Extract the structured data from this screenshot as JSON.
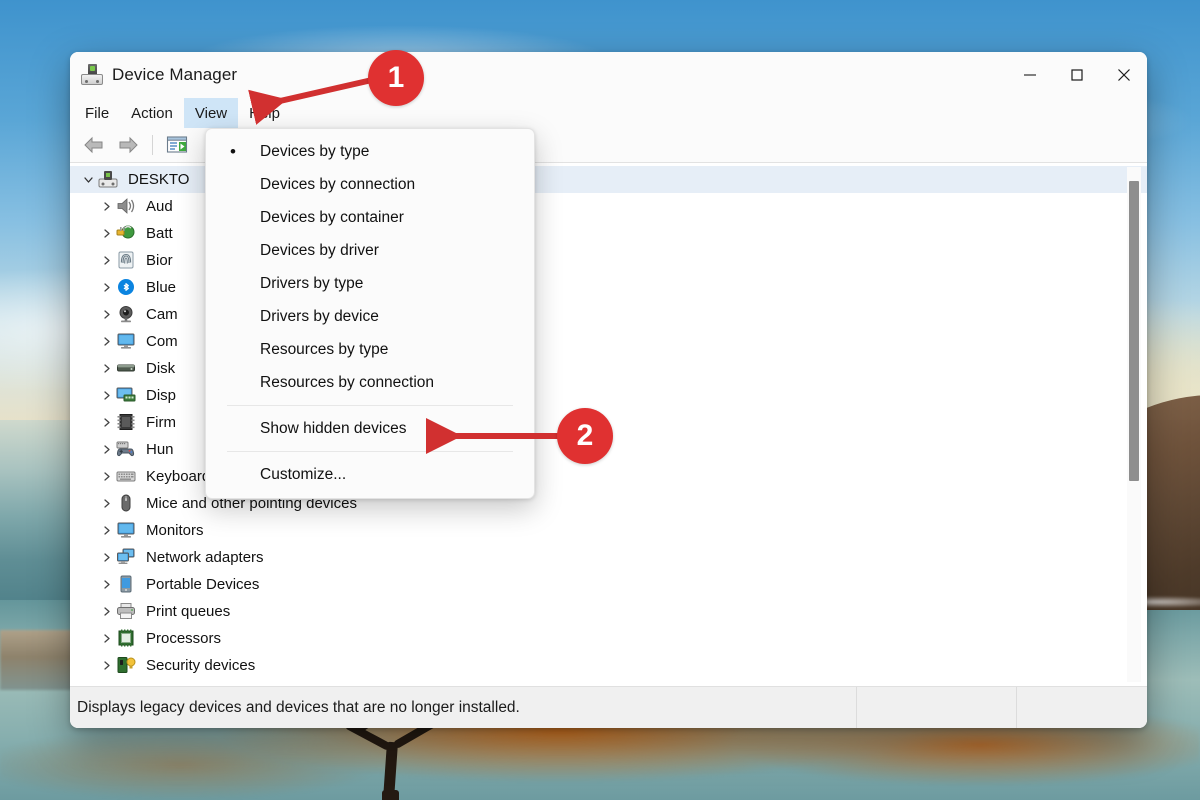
{
  "window": {
    "title": "Device Manager",
    "app_icon": "device-manager-icon",
    "controls": {
      "minimize": "minimize-icon",
      "maximize": "maximize-icon",
      "close": "close-icon"
    }
  },
  "menubar": {
    "items": [
      {
        "label": "File",
        "active": false
      },
      {
        "label": "Action",
        "active": false
      },
      {
        "label": "View",
        "active": true
      },
      {
        "label": "Help",
        "active": false
      }
    ]
  },
  "toolbar": {
    "buttons": [
      {
        "name": "back-button",
        "icon": "back-arrow-icon"
      },
      {
        "name": "forward-button",
        "icon": "forward-arrow-icon"
      },
      {
        "name": "properties-button",
        "icon": "properties-icon"
      }
    ]
  },
  "view_menu": {
    "items": [
      {
        "label": "Devices by type",
        "checked": true
      },
      {
        "label": "Devices by connection",
        "checked": false
      },
      {
        "label": "Devices by container",
        "checked": false
      },
      {
        "label": "Devices by driver",
        "checked": false
      },
      {
        "label": "Drivers by type",
        "checked": false
      },
      {
        "label": "Drivers by device",
        "checked": false
      },
      {
        "label": "Resources by type",
        "checked": false
      },
      {
        "label": "Resources by connection",
        "checked": false
      }
    ],
    "show_hidden": "Show hidden devices",
    "customize": "Customize..."
  },
  "tree": {
    "root": {
      "label": "DESKTO",
      "icon": "computer-icon",
      "expanded": true
    },
    "items": [
      {
        "label": "Aud",
        "icon": "speaker-icon"
      },
      {
        "label": "Batt",
        "icon": "battery-icon"
      },
      {
        "label": "Bior",
        "icon": "fingerprint-icon"
      },
      {
        "label": "Blue",
        "icon": "bluetooth-icon"
      },
      {
        "label": "Cam",
        "icon": "camera-icon"
      },
      {
        "label": "Com",
        "icon": "monitor-icon"
      },
      {
        "label": "Disk",
        "icon": "disk-drive-icon"
      },
      {
        "label": "Disp",
        "icon": "display-adapter-icon"
      },
      {
        "label": "Firm",
        "icon": "firmware-chip-icon"
      },
      {
        "label": "Hun",
        "icon": "hid-gamepad-icon"
      },
      {
        "label": "Keyboards",
        "icon": "keyboard-icon"
      },
      {
        "label": "Mice and other pointing devices",
        "icon": "mouse-icon"
      },
      {
        "label": "Monitors",
        "icon": "monitor-icon"
      },
      {
        "label": "Network adapters",
        "icon": "network-adapter-icon"
      },
      {
        "label": "Portable Devices",
        "icon": "portable-device-icon"
      },
      {
        "label": "Print queues",
        "icon": "printer-icon"
      },
      {
        "label": "Processors",
        "icon": "processor-icon"
      },
      {
        "label": "Security devices",
        "icon": "security-device-icon"
      }
    ]
  },
  "statusbar": {
    "message": "Displays legacy devices and devices that are no longer installed.",
    "segment_2": "",
    "segment_3": ""
  },
  "annotations": [
    {
      "number": "1",
      "target": "view-menu",
      "color": "#e03131"
    },
    {
      "number": "2",
      "target": "show-hidden-devices-item",
      "color": "#e03131"
    }
  ]
}
